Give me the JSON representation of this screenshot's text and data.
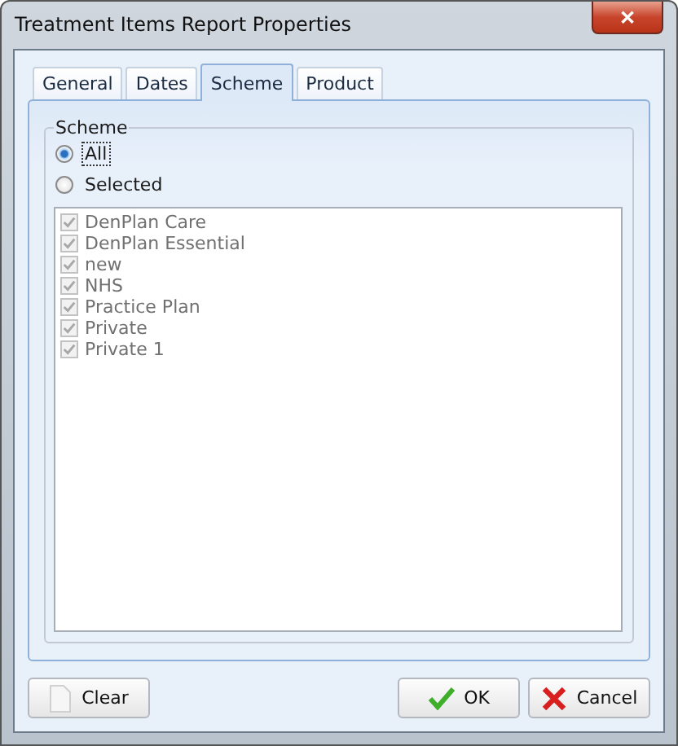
{
  "window": {
    "title": "Treatment Items Report Properties",
    "close": "✕"
  },
  "tabs": [
    {
      "label": "General",
      "selected": false
    },
    {
      "label": "Dates",
      "selected": false
    },
    {
      "label": "Scheme",
      "selected": true
    },
    {
      "label": "Product",
      "selected": false
    }
  ],
  "group": {
    "title": "Scheme",
    "options": [
      {
        "label": "All",
        "selected": true
      },
      {
        "label": "Selected",
        "selected": false
      }
    ],
    "items": [
      {
        "label": "DenPlan Care",
        "checked": true,
        "disabled": true
      },
      {
        "label": "DenPlan Essential",
        "checked": true,
        "disabled": true
      },
      {
        "label": "new",
        "checked": true,
        "disabled": true
      },
      {
        "label": "NHS",
        "checked": true,
        "disabled": true
      },
      {
        "label": "Practice Plan",
        "checked": true,
        "disabled": true
      },
      {
        "label": "Private",
        "checked": true,
        "disabled": true
      },
      {
        "label": "Private 1",
        "checked": true,
        "disabled": true
      }
    ]
  },
  "buttons": [
    {
      "label": "Clear",
      "kind": "clear"
    },
    {
      "label": "OK",
      "kind": "ok"
    },
    {
      "label": "Cancel",
      "kind": "cancel"
    }
  ]
}
